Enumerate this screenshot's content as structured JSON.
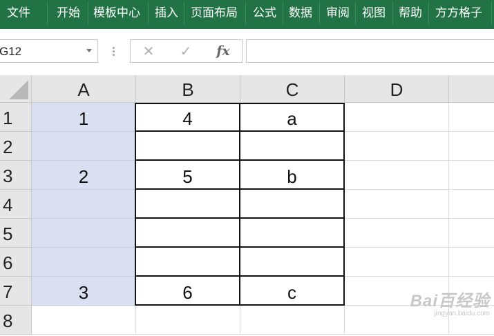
{
  "ribbon": {
    "tabs": [
      {
        "label": "文件"
      },
      {
        "label": "开始"
      },
      {
        "label": "模板中心"
      },
      {
        "label": "插入"
      },
      {
        "label": "页面布局"
      },
      {
        "label": "公式"
      },
      {
        "label": "数据"
      },
      {
        "label": "审阅"
      },
      {
        "label": "视图"
      },
      {
        "label": "帮助"
      },
      {
        "label": "方方格子"
      }
    ]
  },
  "formula_bar": {
    "name_box": "G12",
    "cancel_icon": "✕",
    "enter_icon": "✓",
    "fx_label": "fx",
    "formula": ""
  },
  "sheet": {
    "columns": [
      "A",
      "B",
      "C",
      "D"
    ],
    "rows": [
      {
        "num": "1",
        "cells": [
          "1",
          "4",
          "a",
          ""
        ]
      },
      {
        "num": "2",
        "cells": [
          "",
          "",
          "",
          ""
        ]
      },
      {
        "num": "3",
        "cells": [
          "2",
          "5",
          "b",
          ""
        ]
      },
      {
        "num": "4",
        "cells": [
          "",
          "",
          "",
          ""
        ]
      },
      {
        "num": "5",
        "cells": [
          "",
          "",
          "",
          ""
        ]
      },
      {
        "num": "6",
        "cells": [
          "",
          "",
          "",
          ""
        ]
      },
      {
        "num": "7",
        "cells": [
          "3",
          "6",
          "c",
          ""
        ]
      },
      {
        "num": "8",
        "cells": [
          "",
          "",
          "",
          ""
        ]
      }
    ]
  },
  "colors": {
    "ribbon": "#217346",
    "selected_fill": "#dae0f2"
  },
  "watermark": {
    "main": "Bai百经验",
    "sub": "jingyan.baidu.com"
  }
}
